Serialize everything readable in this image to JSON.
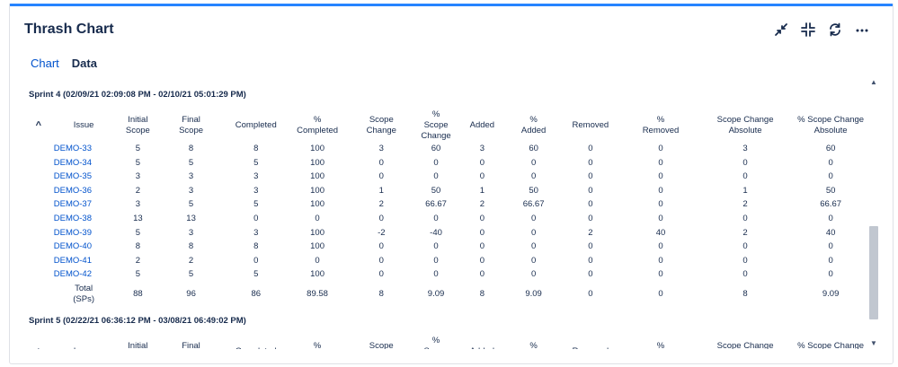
{
  "title": "Thrash Chart",
  "tabs": [
    {
      "label": "Chart",
      "active": false
    },
    {
      "label": "Data",
      "active": true
    }
  ],
  "actions": [
    "minimize-icon",
    "collapse-icon",
    "refresh-icon",
    "more-icon"
  ],
  "columns": [
    "Issue",
    "Initial\nScope",
    "Final\nScope",
    "Completed",
    "%\nCompleted",
    "Scope\nChange",
    "% Scope\nChange",
    "Added",
    "%\nAdded",
    "Removed",
    "%\nRemoved",
    "Scope Change\nAbsolute",
    "% Scope Change\nAbsolute"
  ],
  "sprints": [
    {
      "title": "Sprint 4 (02/09/21 02:09:08 PM - 02/10/21 05:01:29 PM)",
      "toggle": "^",
      "rows": [
        [
          "DEMO-33",
          "5",
          "8",
          "8",
          "100",
          "3",
          "60",
          "3",
          "60",
          "0",
          "0",
          "3",
          "60"
        ],
        [
          "DEMO-34",
          "5",
          "5",
          "5",
          "100",
          "0",
          "0",
          "0",
          "0",
          "0",
          "0",
          "0",
          "0"
        ],
        [
          "DEMO-35",
          "3",
          "3",
          "3",
          "100",
          "0",
          "0",
          "0",
          "0",
          "0",
          "0",
          "0",
          "0"
        ],
        [
          "DEMO-36",
          "2",
          "3",
          "3",
          "100",
          "1",
          "50",
          "1",
          "50",
          "0",
          "0",
          "1",
          "50"
        ],
        [
          "DEMO-37",
          "3",
          "5",
          "5",
          "100",
          "2",
          "66.67",
          "2",
          "66.67",
          "0",
          "0",
          "2",
          "66.67"
        ],
        [
          "DEMO-38",
          "13",
          "13",
          "0",
          "0",
          "0",
          "0",
          "0",
          "0",
          "0",
          "0",
          "0",
          "0"
        ],
        [
          "DEMO-39",
          "5",
          "3",
          "3",
          "100",
          "-2",
          "-40",
          "0",
          "0",
          "2",
          "40",
          "2",
          "40"
        ],
        [
          "DEMO-40",
          "8",
          "8",
          "8",
          "100",
          "0",
          "0",
          "0",
          "0",
          "0",
          "0",
          "0",
          "0"
        ],
        [
          "DEMO-41",
          "2",
          "2",
          "0",
          "0",
          "0",
          "0",
          "0",
          "0",
          "0",
          "0",
          "0",
          "0"
        ],
        [
          "DEMO-42",
          "5",
          "5",
          "5",
          "100",
          "0",
          "0",
          "0",
          "0",
          "0",
          "0",
          "0",
          "0"
        ]
      ],
      "total": [
        "Total\n(SPs)",
        "88",
        "96",
        "86",
        "89.58",
        "8",
        "9.09",
        "8",
        "9.09",
        "0",
        "0",
        "8",
        "9.09"
      ]
    },
    {
      "title": "Sprint 5 (02/22/21 06:36:12 PM - 03/08/21 06:49:02 PM)",
      "toggle": "+",
      "rows": [],
      "total": null
    }
  ]
}
